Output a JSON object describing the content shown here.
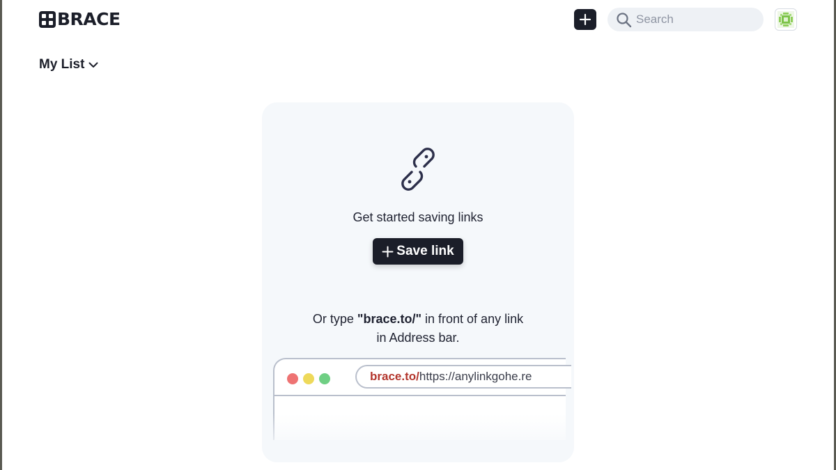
{
  "header": {
    "logo_text": "BRACE",
    "search_placeholder": "Search",
    "icons": {
      "add": "plus-icon",
      "search": "search-icon",
      "avatar": "avatar-icon"
    }
  },
  "list_selector": {
    "label": "My List"
  },
  "empty_state": {
    "message": "Get started saving links",
    "save_button_label": "Save link",
    "hint_prefix": "Or type ",
    "hint_code": "\"brace.to/\"",
    "hint_suffix": " in front of any link",
    "hint_line2": "in Address bar.",
    "address_prefix": "brace.to/",
    "address_url": "https://anylinkgohe.re"
  },
  "colors": {
    "dark": "#1b1e29",
    "card_bg": "#f5f8fb",
    "accent_red": "#b3352c",
    "dot_red": "#ee7373",
    "dot_yellow": "#eed95a",
    "dot_green": "#6fcf84"
  }
}
